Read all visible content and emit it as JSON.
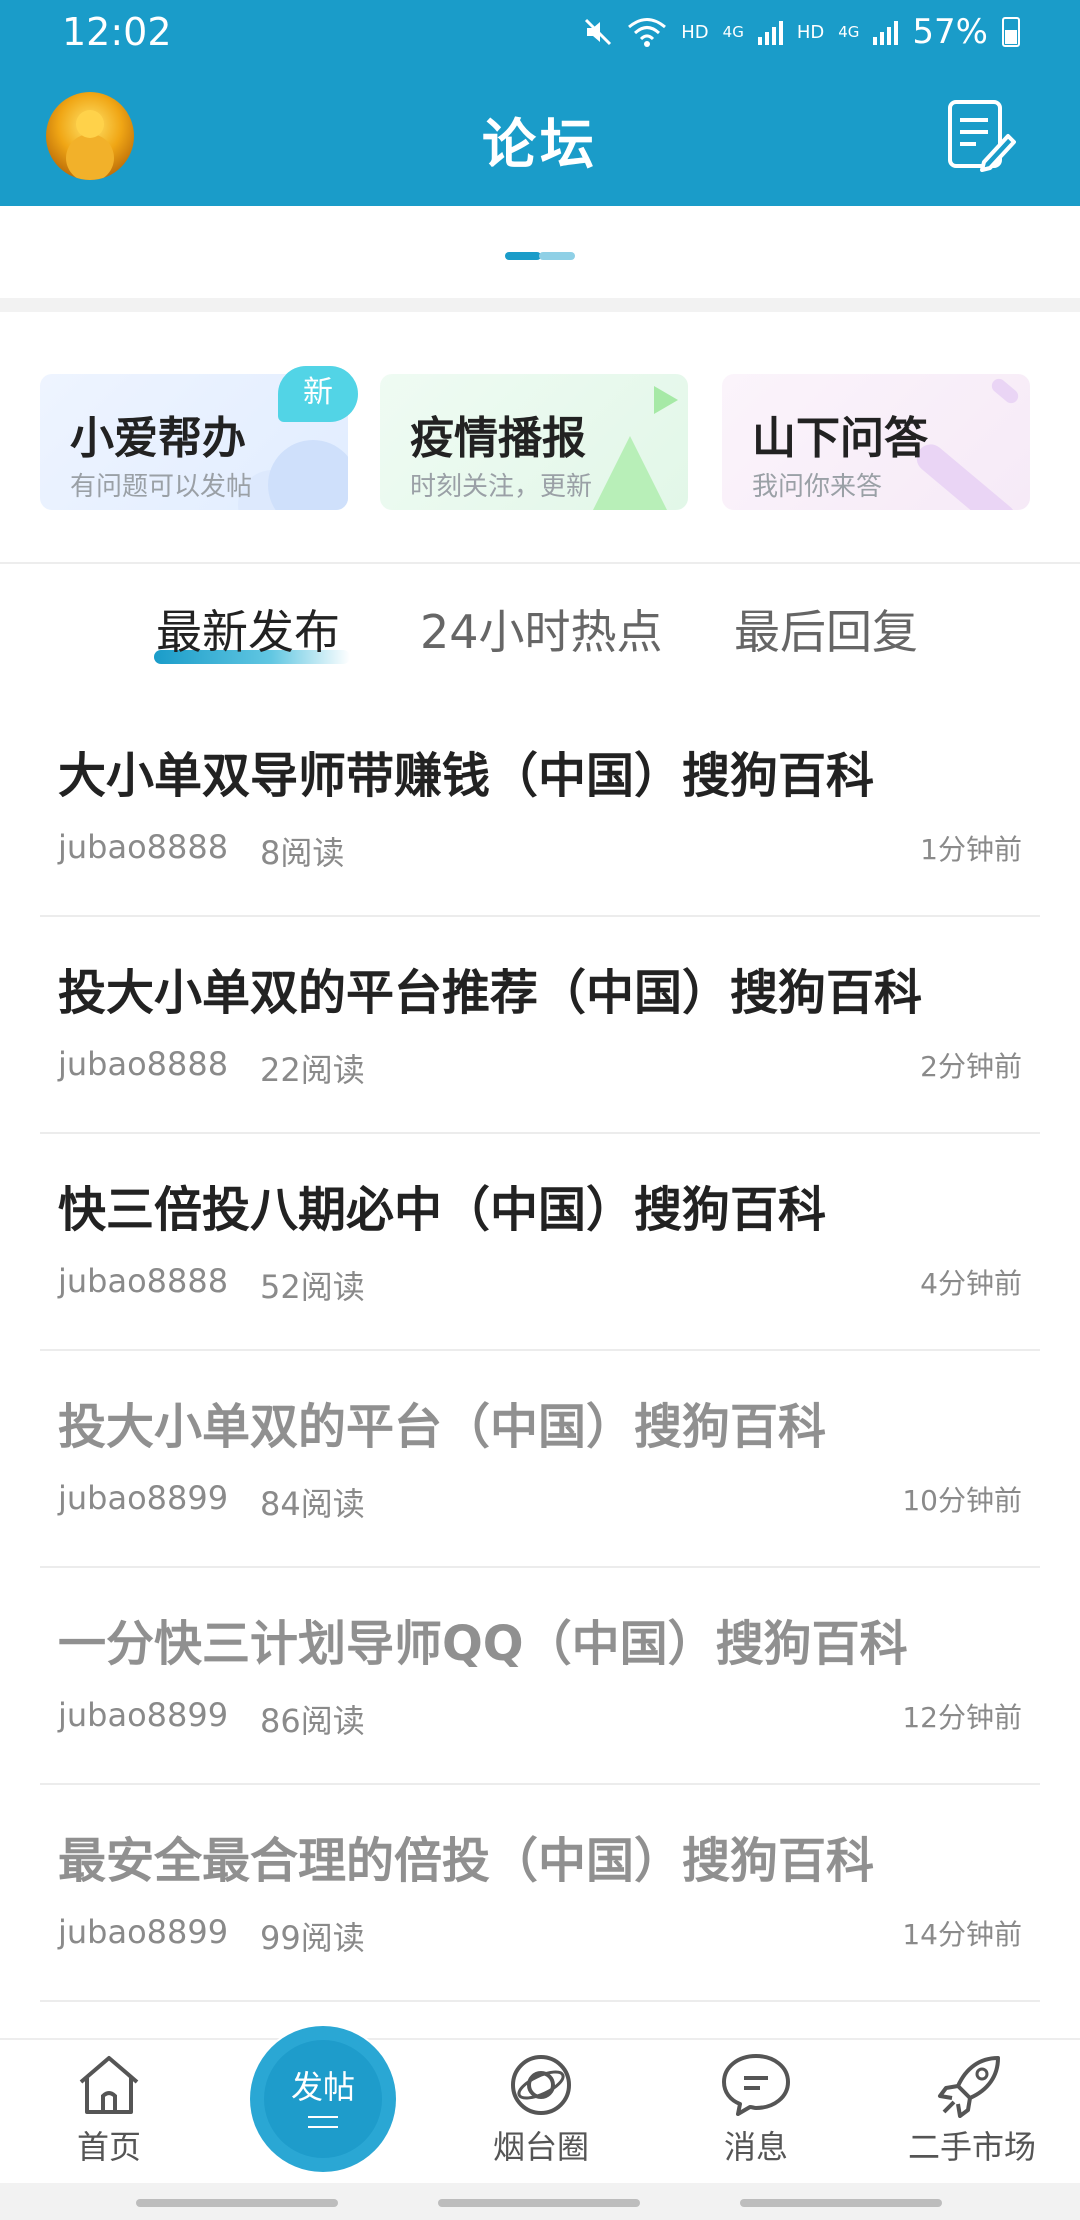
{
  "status_bar": {
    "time": "12:02",
    "net1": "HD",
    "net1_type": "4G",
    "net2": "HD",
    "net2_type": "4G",
    "battery": "57%"
  },
  "header": {
    "title": "论坛",
    "avatar_icon": "buddha-avatar",
    "compose_icon": "compose-icon"
  },
  "feature_cards": [
    {
      "title": "小爱帮办",
      "subtitle": "有问题可以发帖",
      "badge": "新"
    },
    {
      "title": "疫情播报",
      "subtitle": "时刻关注，更新"
    },
    {
      "title": "山下问答",
      "subtitle": "我问你来答"
    }
  ],
  "tabs": [
    {
      "label": "最新发布",
      "active": true
    },
    {
      "label": "24小时热点",
      "active": false
    },
    {
      "label": "最后回复",
      "active": false
    }
  ],
  "posts": [
    {
      "title": "大小单双导师带赚钱（中国）搜狗百科",
      "author": "jubao8888",
      "reads": "8阅读",
      "time": "1分钟前",
      "read": false
    },
    {
      "title": "投大小单双的平台推荐（中国）搜狗百科",
      "author": "jubao8888",
      "reads": "22阅读",
      "time": "2分钟前",
      "read": false
    },
    {
      "title": "快三倍投八期必中（中国）搜狗百科",
      "author": "jubao8888",
      "reads": "52阅读",
      "time": "4分钟前",
      "read": false
    },
    {
      "title": "投大小单双的平台（中国）搜狗百科",
      "author": "jubao8899",
      "reads": "84阅读",
      "time": "10分钟前",
      "read": true
    },
    {
      "title": "一分快三计划导师QQ（中国）搜狗百科",
      "author": "jubao8899",
      "reads": "86阅读",
      "time": "12分钟前",
      "read": true
    },
    {
      "title": "最安全最合理的倍投（中国）搜狗百科",
      "author": "jubao8899",
      "reads": "99阅读",
      "time": "14分钟前",
      "read": true
    }
  ],
  "bottom_nav": {
    "home": "首页",
    "post": "发帖",
    "circle": "烟台圈",
    "messages": "消息",
    "market": "二手市场"
  },
  "colors": {
    "primary": "#1a9cc9",
    "read_title": "#909090",
    "text": "#222222"
  }
}
